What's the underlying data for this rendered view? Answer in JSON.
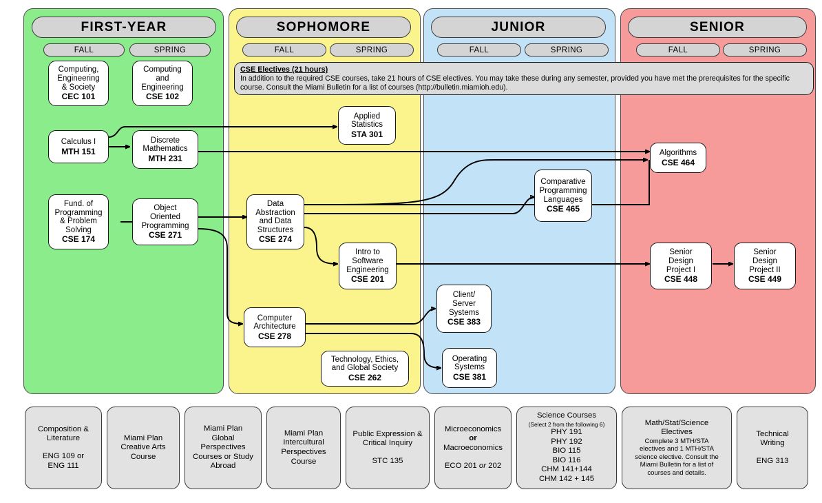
{
  "title": "Computer Science Curriculum Flowchart",
  "columns": [
    {
      "key": "first",
      "title": "FIRST-YEAR",
      "fall": "FALL",
      "spring": "SPRING",
      "color": "#8aec8a"
    },
    {
      "key": "soph",
      "title": "SOPHOMORE",
      "fall": "FALL",
      "spring": "SPRING",
      "color": "#fbf48c"
    },
    {
      "key": "junior",
      "title": "JUNIOR",
      "fall": "FALL",
      "spring": "SPRING",
      "color": "#c2e2f7"
    },
    {
      "key": "senior",
      "title": "SENIOR",
      "fall": "FALL",
      "spring": "SPRING",
      "color": "#f79a9a"
    }
  ],
  "banner": {
    "title": "CSE Electives (21 hours)",
    "text": "In addition to the required CSE courses, take 21 hours of CSE electives.  You may take these during any semester, provided you have met the prerequisites for the specific course.  Consult the Miami Bulletin for a list of courses (http://bulletin.miamioh.edu)."
  },
  "courses": [
    {
      "id": "cec101",
      "name": "Computing,\nEngineering\n& Society",
      "code": "CEC 101"
    },
    {
      "id": "cse102",
      "name": "Computing\nand\nEngineering",
      "code": "CSE 102"
    },
    {
      "id": "mth151",
      "name": "Calculus I",
      "code": "MTH 151"
    },
    {
      "id": "mth231",
      "name": "Discrete\nMathematics",
      "code": "MTH 231"
    },
    {
      "id": "cse174",
      "name": "Fund. of\nProgramming\n& Problem\nSolving",
      "code": "CSE 174"
    },
    {
      "id": "cse271",
      "name": "Object\nOriented\nProgramming",
      "code": "CSE 271"
    },
    {
      "id": "sta301",
      "name": "Applied\nStatistics",
      "code": "STA 301"
    },
    {
      "id": "cse274",
      "name": "Data\nAbstraction\nand Data\nStructures",
      "code": "CSE 274"
    },
    {
      "id": "cse201",
      "name": "Intro to\nSoftware\nEngineering",
      "code": "CSE 201"
    },
    {
      "id": "cse278",
      "name": "Computer\nArchitecture",
      "code": "CSE 278"
    },
    {
      "id": "cse262",
      "name": "Technology, Ethics,\nand Global Society",
      "code": "CSE 262"
    },
    {
      "id": "cse465",
      "name": "Comparative\nProgramming\nLanguages",
      "code": "CSE 465"
    },
    {
      "id": "cse383",
      "name": "Client/\nServer\nSystems",
      "code": "CSE 383"
    },
    {
      "id": "cse381",
      "name": "Operating\nSystems",
      "code": "CSE 381"
    },
    {
      "id": "cse464",
      "name": "Algorithms",
      "code": "CSE 464"
    },
    {
      "id": "cse448",
      "name": "Senior\nDesign\nProject I",
      "code": "CSE 448"
    },
    {
      "id": "cse449",
      "name": "Senior\nDesign\nProject II",
      "code": "CSE 449"
    }
  ],
  "requirements": [
    {
      "id": "req1",
      "line1": "Composition &\nLiterature",
      "line2": "ENG 109 or\nENG 111"
    },
    {
      "id": "req2",
      "line1": "Miami Plan\nCreative Arts\nCourse",
      "line2": ""
    },
    {
      "id": "req3",
      "line1": "Miami Plan\nGlobal\nPerspectives\nCourses or Study\nAbroad",
      "line2": ""
    },
    {
      "id": "req4",
      "line1": "Miami Plan\nIntercultural\nPerspectives\nCourse",
      "line2": ""
    },
    {
      "id": "req5",
      "line1": "Public Expression &\nCritical Inquiry",
      "line2": "STC 135"
    },
    {
      "id": "req6",
      "line1": "Microeconomics\nor\nMacroeconomics",
      "line2": "ECO 201 or 202",
      "italicWord": "or"
    },
    {
      "id": "req7",
      "line1": "Science Courses",
      "small": "(Select 2 from the following 6)",
      "list": "PHY 191\nPHY 192\nBIO 115\nBIO 116\nCHM 141+144\nCHM 142 + 145"
    },
    {
      "id": "req8",
      "line1": "Math/Stat/Science\nElectives",
      "tight": "Complete 3 MTH/STA\nelectives and 1 MTH/STA\nscience elective. Consult the\nMiami Bulletin for a list of\ncourses and details."
    },
    {
      "id": "req9",
      "line1": "Technical\nWriting",
      "line2": "ENG 313"
    }
  ],
  "edges": [
    {
      "from": "mth151",
      "to": "sta301"
    },
    {
      "from": "mth151",
      "to": "mth231"
    },
    {
      "from": "mth231",
      "to": "cse464"
    },
    {
      "from": "cse174",
      "to": "cse271"
    },
    {
      "from": "cse271",
      "to": "cse274"
    },
    {
      "from": "cse271",
      "to": "cse278"
    },
    {
      "from": "cse274",
      "to": "cse464"
    },
    {
      "from": "cse274",
      "to": "cse465"
    },
    {
      "from": "cse274",
      "to": "cse201"
    },
    {
      "from": "cse201",
      "to": "cse465"
    },
    {
      "from": "cse201",
      "to": "cse448"
    },
    {
      "from": "cse278",
      "to": "cse383"
    },
    {
      "from": "cse278",
      "to": "cse381"
    },
    {
      "from": "cse448",
      "to": "cse449"
    }
  ]
}
